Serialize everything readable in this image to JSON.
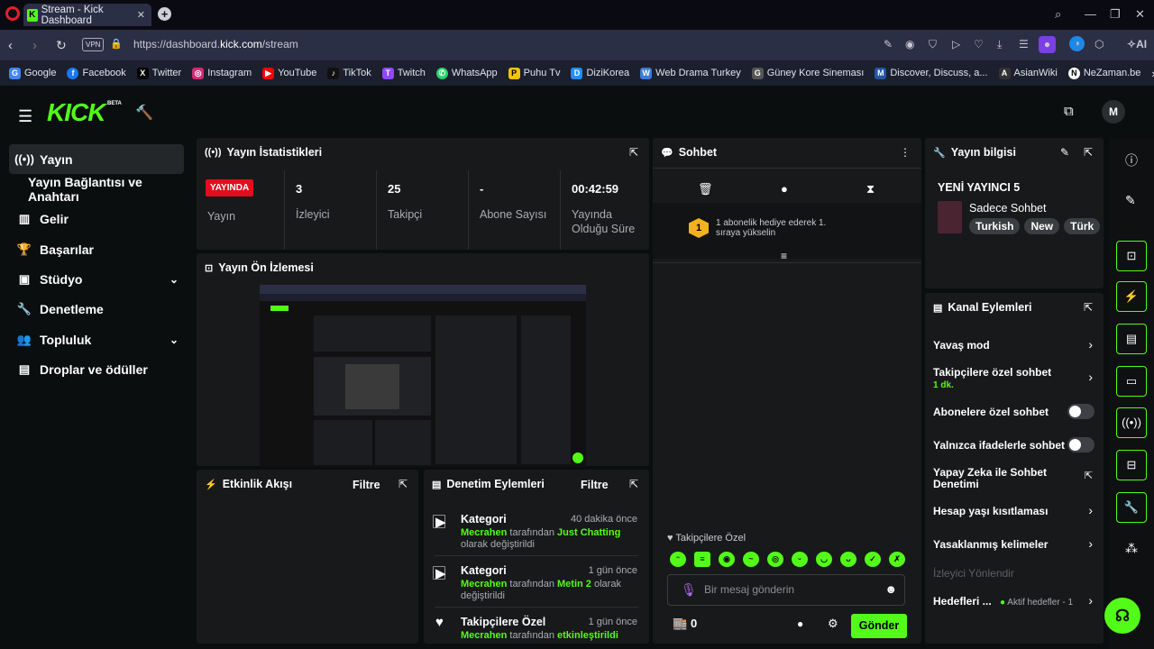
{
  "browser": {
    "tab_title": "Stream - Kick Dashboard",
    "url_prefix": "https://dashboard.",
    "url_domain": "kick.com",
    "url_path": "/stream",
    "vpn": "VPN",
    "ai_label": "AI",
    "bookmarks": [
      {
        "label": "Google",
        "color": "#4285f4",
        "icon": "G"
      },
      {
        "label": "Facebook",
        "color": "#1877f2",
        "icon": "f"
      },
      {
        "label": "Twitter",
        "color": "#000000",
        "icon": "X"
      },
      {
        "label": "Instagram",
        "color": "#d62976",
        "icon": "◎"
      },
      {
        "label": "YouTube",
        "color": "#ff0000",
        "icon": "▶"
      },
      {
        "label": "TikTok",
        "color": "#111111",
        "icon": "♪"
      },
      {
        "label": "Twitch",
        "color": "#9146ff",
        "icon": "T"
      },
      {
        "label": "WhatsApp",
        "color": "#25d366",
        "icon": "✆"
      },
      {
        "label": "Puhu Tv",
        "color": "#f5c400",
        "icon": "P"
      },
      {
        "label": "DiziKorea",
        "color": "#1e90ff",
        "icon": "D"
      },
      {
        "label": "Web Drama Turkey",
        "color": "#3a7bd5",
        "icon": "W"
      },
      {
        "label": "Güney Kore Sineması",
        "color": "#555555",
        "icon": "G"
      },
      {
        "label": "Discover, Discuss, a...",
        "color": "#2255aa",
        "icon": "M"
      },
      {
        "label": "AsianWiki",
        "color": "#333333",
        "icon": "A"
      },
      {
        "label": "NeZaman.be",
        "color": "#ffffff",
        "icon": "N"
      }
    ]
  },
  "header": {
    "logo": "KICK",
    "beta": "BETA",
    "avatar": "M"
  },
  "sidebar": {
    "items": [
      {
        "label": "Yayın"
      },
      {
        "label": "Yayın Bağlantısı ve Anahtarı"
      },
      {
        "label": "Gelir"
      },
      {
        "label": "Başarılar"
      },
      {
        "label": "Stüdyo"
      },
      {
        "label": "Denetleme"
      },
      {
        "label": "Topluluk"
      },
      {
        "label": "Droplar ve ödüller"
      }
    ]
  },
  "stats": {
    "title": "Yayın İstatistikleri",
    "live_badge": "YAYINDA",
    "live_label": "Yayın",
    "viewers": "3",
    "viewers_label": "İzleyici",
    "followers": "25",
    "followers_label": "Takipçi",
    "subs": "-",
    "subs_label": "Abone Sayısı",
    "duration": "00:42:59",
    "duration_label": "Yayında Olduğu Süre"
  },
  "preview": {
    "title": "Yayın Ön İzlemesi"
  },
  "activity": {
    "title": "Etkinlik Akışı",
    "filter": "Filtre"
  },
  "modlog": {
    "title": "Denetim Eylemleri",
    "filter": "Filtre",
    "items": [
      {
        "title": "Kategori",
        "time": "40 dakika önce",
        "user": "Mecrahen",
        "mid": " tarafından ",
        "target": "Just Chatting",
        "end": " olarak değiştirildi"
      },
      {
        "title": "Kategori",
        "time": "1 gün önce",
        "user": "Mecrahen",
        "mid": " tarafından ",
        "target": "Metin 2",
        "end": " olarak değiştirildi"
      },
      {
        "title": "Takipçilere Özel",
        "time": "1 gün önce",
        "user": "Mecrahen",
        "mid": " tarafından ",
        "target": "etkinleştirildi",
        "end": ""
      }
    ]
  },
  "chat": {
    "title": "Sohbet",
    "gift_rank": "1",
    "gift_text": "1 abonelik hediye ederek 1. sıraya yükselin",
    "followers_only": "Takipçilere Özel",
    "placeholder": "Bir mesaj gönderin",
    "count": "0",
    "send": "Gönder"
  },
  "stream_info": {
    "title": "Yayın bilgisi",
    "stream_title": "YENİ YAYINCI 5",
    "category": "Sadece Sohbet",
    "tags": [
      "Turkish",
      "New",
      "Türk"
    ]
  },
  "channel_actions": {
    "title": "Kanal Eylemleri",
    "slow": "Yavaş mod",
    "followers_chat": "Takipçilere özel sohbet",
    "followers_chat_sub": "1 dk.",
    "subs_chat": "Abonelere özel sohbet",
    "emote_chat": "Yalnızca ifadelerle sohbet",
    "ai_mod": "Yapay Zeka ile Sohbet Denetimi",
    "age": "Hesap yaşı kısıtlaması",
    "banned": "Yasaklanmış kelimeler",
    "viewer_guide": "İzleyici Yönlendir",
    "goals": "Hedefleri ...",
    "goals_sub": "Aktif hedefler - 1"
  }
}
